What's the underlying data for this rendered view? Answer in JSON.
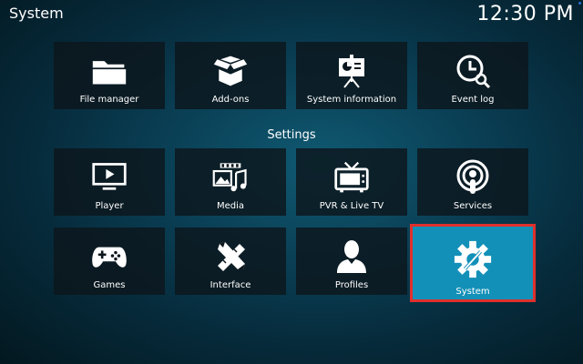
{
  "header": {
    "title": "System",
    "clock": "12:30 PM"
  },
  "top_row": [
    {
      "label": "File manager",
      "icon": "folder-icon"
    },
    {
      "label": "Add-ons",
      "icon": "open-box-icon"
    },
    {
      "label": "System information",
      "icon": "presentation-board-icon"
    },
    {
      "label": "Event log",
      "icon": "clock-search-icon"
    }
  ],
  "settings": {
    "label": "Settings",
    "items": [
      {
        "label": "Player",
        "icon": "tv-play-icon"
      },
      {
        "label": "Media",
        "icon": "media-film-music-icon"
      },
      {
        "label": "PVR & Live TV",
        "icon": "retro-tv-icon"
      },
      {
        "label": "Services",
        "icon": "podcast-broadcast-icon"
      },
      {
        "label": "Games",
        "icon": "gamepad-icon"
      },
      {
        "label": "Interface",
        "icon": "pencil-ruler-icon"
      },
      {
        "label": "Profiles",
        "icon": "user-profile-icon"
      },
      {
        "label": "System",
        "icon": "gear-wrench-icon",
        "focused": true
      }
    ]
  },
  "colors": {
    "focus_fill": "#1390b8",
    "focus_border": "#e0302c",
    "tile_bg": "#0c161c"
  }
}
